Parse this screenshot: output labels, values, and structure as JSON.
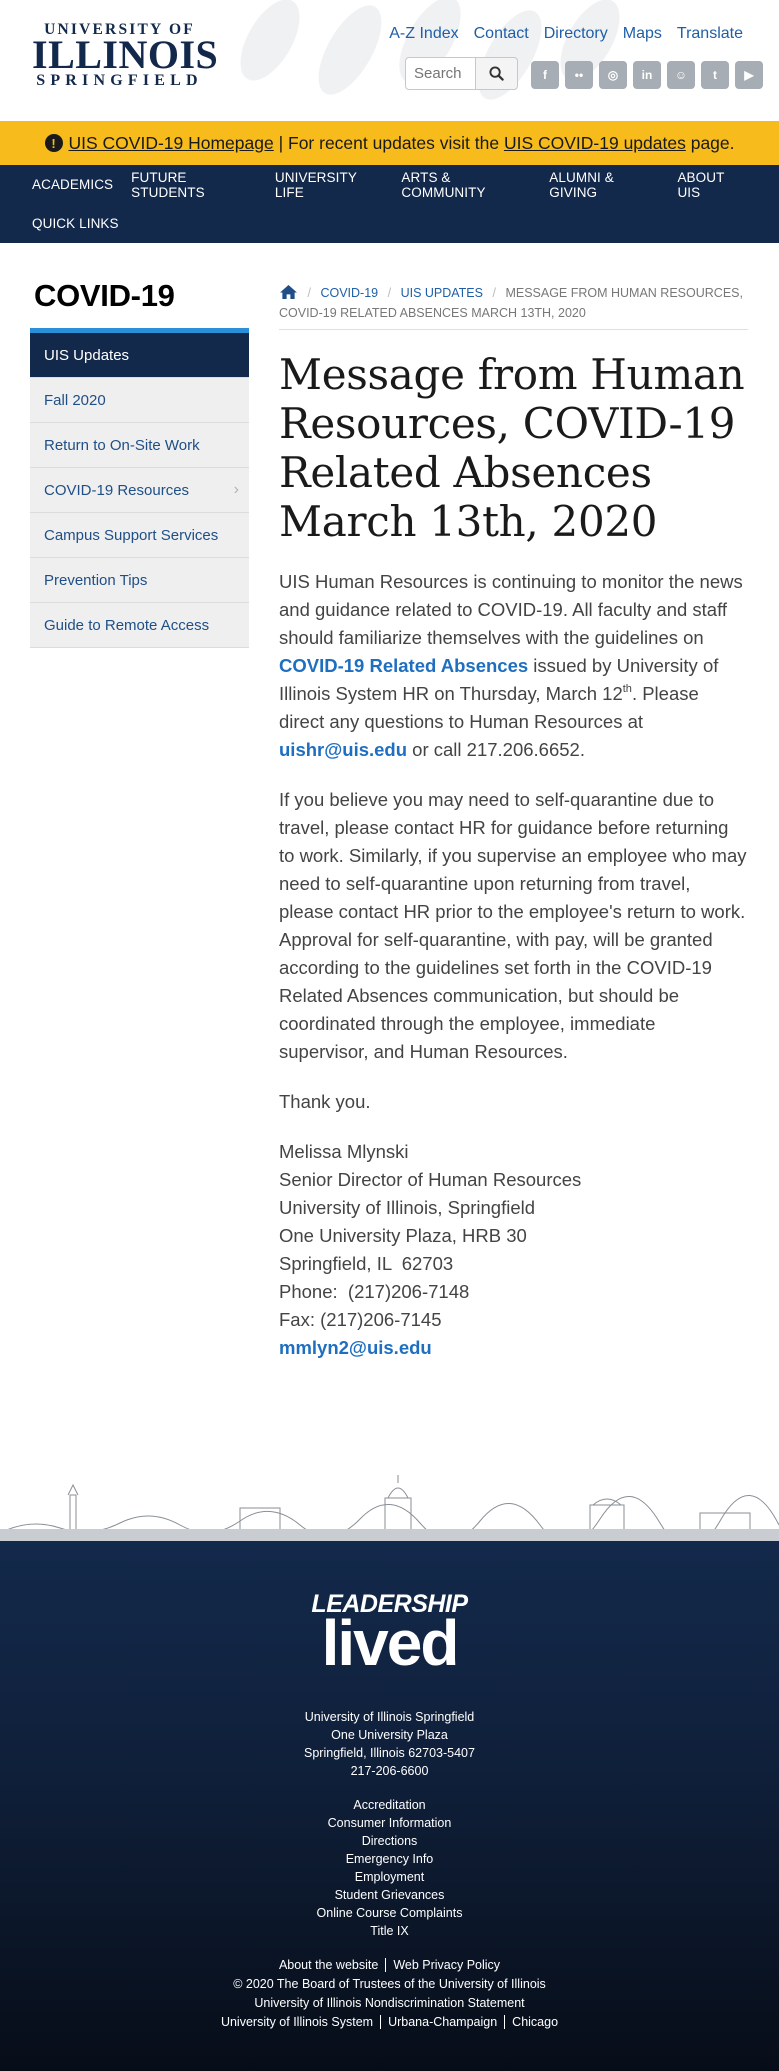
{
  "header": {
    "logo": {
      "top": "UNIVERSITY OF",
      "main": "ILLINOIS",
      "bottom": "SPRINGFIELD"
    },
    "top_links": [
      "A-Z Index",
      "Contact",
      "Directory",
      "Maps",
      "Translate"
    ],
    "search": {
      "placeholder": "Search",
      "button_icon": "search-icon"
    },
    "social_icons": [
      "facebook-icon",
      "flickr-icon",
      "instagram-icon",
      "linkedin-icon",
      "snapchat-icon",
      "twitter-icon",
      "youtube-icon"
    ]
  },
  "alert": {
    "icon": "exclamation-circle-icon",
    "link1": "UIS COVID-19 Homepage",
    "middle": " | For recent updates visit the ",
    "link2": "UIS COVID-19 updates",
    "end": " page.",
    "background": "#f7bb1c"
  },
  "nav": {
    "items": [
      "Academics",
      "Future Students",
      "University Life",
      "Arts & Community",
      "Alumni & Giving",
      "About UIS"
    ],
    "items_row2": [
      "Quick Links"
    ],
    "background": "#13294b"
  },
  "sidebar": {
    "title": "COVID-19",
    "items": [
      {
        "label": "UIS Updates",
        "active": true
      },
      {
        "label": "Fall 2020"
      },
      {
        "label": "Return to On-Site Work"
      },
      {
        "label": "COVID-19 Resources",
        "has_children": true
      },
      {
        "label": "Campus Support Services"
      },
      {
        "label": "Prevention Tips"
      },
      {
        "label": "Guide to Remote Access"
      }
    ],
    "accent": "#2b8fd8"
  },
  "breadcrumb": {
    "home_icon": "home-icon",
    "items": [
      "COVID-19",
      "UIS UPDATES"
    ],
    "current": "MESSAGE FROM HUMAN RESOURCES, COVID-19 RELATED ABSENCES MARCH 13TH, 2020"
  },
  "article": {
    "title": "Message from Human Resources, COVID-19 Related Absences March 13th, 2020",
    "p1_a": "UIS Human Resources is continuing to monitor the news and guidance related to COVID-19.  All faculty and staff should familiarize themselves with the guidelines on ",
    "p1_link": "COVID-19 Related Absences",
    "p1_b": " issued by University of Illinois System HR on Thursday, March 12",
    "p1_sup": "th",
    "p1_c": ".  Please direct any questions to Human Resources at ",
    "p1_email": "uishr@uis.edu",
    "p1_d": " or call 217.206.6652.",
    "p2": "If you believe you may need to self-quarantine due to travel, please contact HR for guidance before returning to work. Similarly, if you supervise an employee who may need to self-quarantine upon returning from travel, please contact HR prior to the employee's return to work. Approval for self-quarantine, with pay, will be granted according to the guidelines set forth in the COVID-19 Related Absences communication, but should be coordinated through the employee, immediate supervisor, and Human Resources.",
    "p3": "Thank you.",
    "signature": [
      "Melissa Mlynski",
      "Senior Director of Human Resources",
      "University of Illinois, Springfield",
      "One University Plaza, HRB 30",
      "Springfield, IL  62703",
      "Phone:  (217)206-7148",
      "Fax: (217)206-7145"
    ],
    "signature_email": "mmlyn2@uis.edu",
    "link_color": "#1f6fc1"
  },
  "footer": {
    "brand_top": "LEADERSHIP",
    "brand_bottom": "lived",
    "address": [
      "University of Illinois Springfield",
      "One University Plaza",
      "Springfield, Illinois 62703-5407",
      "217-206-6600"
    ],
    "links": [
      "Accreditation",
      "Consumer Information",
      "Directions",
      "Emergency Info",
      "Employment",
      "Student Grievances",
      "Online Course Complaints",
      "Title IX"
    ],
    "row1": [
      "About the website",
      "Web Privacy Policy"
    ],
    "copyright": "© 2020 The Board of Trustees of the University of Illinois",
    "nondiscrimination": "University of Illinois Nondiscrimination Statement",
    "row2": [
      "University of Illinois System",
      "Urbana-Champaign",
      "Chicago"
    ],
    "background": "#13294b"
  }
}
